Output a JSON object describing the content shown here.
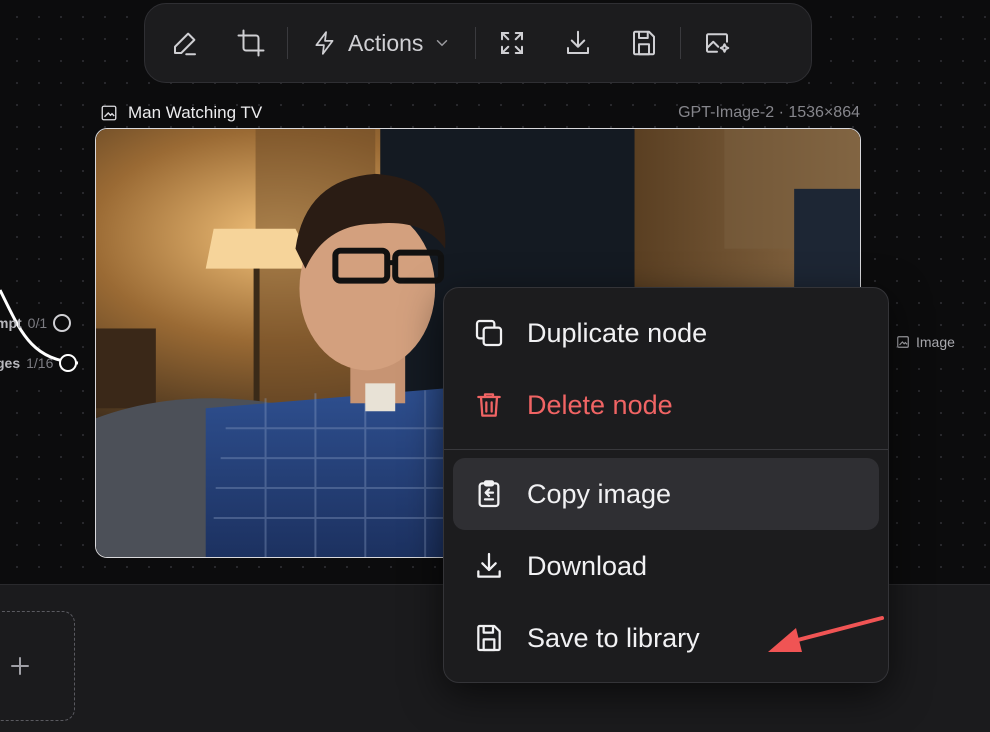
{
  "toolbar": {
    "actions_label": "Actions",
    "icons": [
      "pencil-icon",
      "crop-icon",
      "bolt-icon",
      "chevron-down-icon",
      "fullscreen-icon",
      "download-icon",
      "save-icon",
      "image-edit-icon"
    ]
  },
  "node": {
    "title": "Man Watching TV",
    "meta": "GPT-Image-2 · 1536×864",
    "output_port_label": "Image"
  },
  "input_ports": [
    {
      "label": "mpt",
      "count": "0/1"
    },
    {
      "label": "ges",
      "count": "1/16"
    }
  ],
  "context_menu": {
    "items": [
      {
        "label": "Duplicate node",
        "icon": "duplicate-icon",
        "style": "normal"
      },
      {
        "label": "Delete node",
        "icon": "trash-icon",
        "style": "danger"
      },
      {
        "label": "Copy image",
        "icon": "clipboard-icon",
        "style": "highlighted"
      },
      {
        "label": "Download",
        "icon": "download-icon",
        "style": "normal"
      },
      {
        "label": "Save to library",
        "icon": "save-icon",
        "style": "normal"
      }
    ]
  },
  "colors": {
    "danger": "#f06464",
    "annotation_arrow": "#f05454",
    "menu_bg": "#1c1c1e"
  }
}
